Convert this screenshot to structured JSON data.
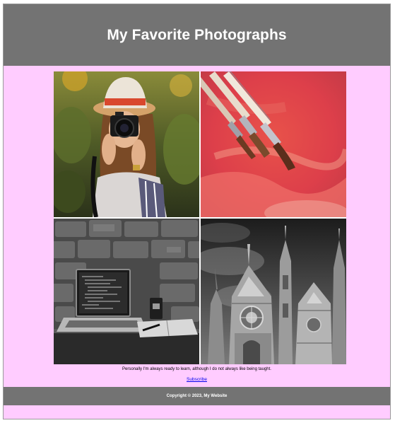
{
  "header": {
    "title": "My Favorite Photographs"
  },
  "gallery": {
    "photos": [
      {
        "subject": "woman-with-camera"
      },
      {
        "subject": "paintbrushes-on-red-paint"
      },
      {
        "subject": "laptop-on-desk-bw"
      },
      {
        "subject": "gothic-cathedral-bw"
      }
    ]
  },
  "caption": {
    "text": "Personally I'm always ready to learn, although I do not always like being taught."
  },
  "subscribe": {
    "label": "Subscribe"
  },
  "footer": {
    "copyright": "Copyright © 2023, My Website"
  },
  "colors": {
    "page_background": "#ffccff",
    "header_background": "#737373",
    "footer_background": "#737373",
    "link": "#0000ee"
  }
}
